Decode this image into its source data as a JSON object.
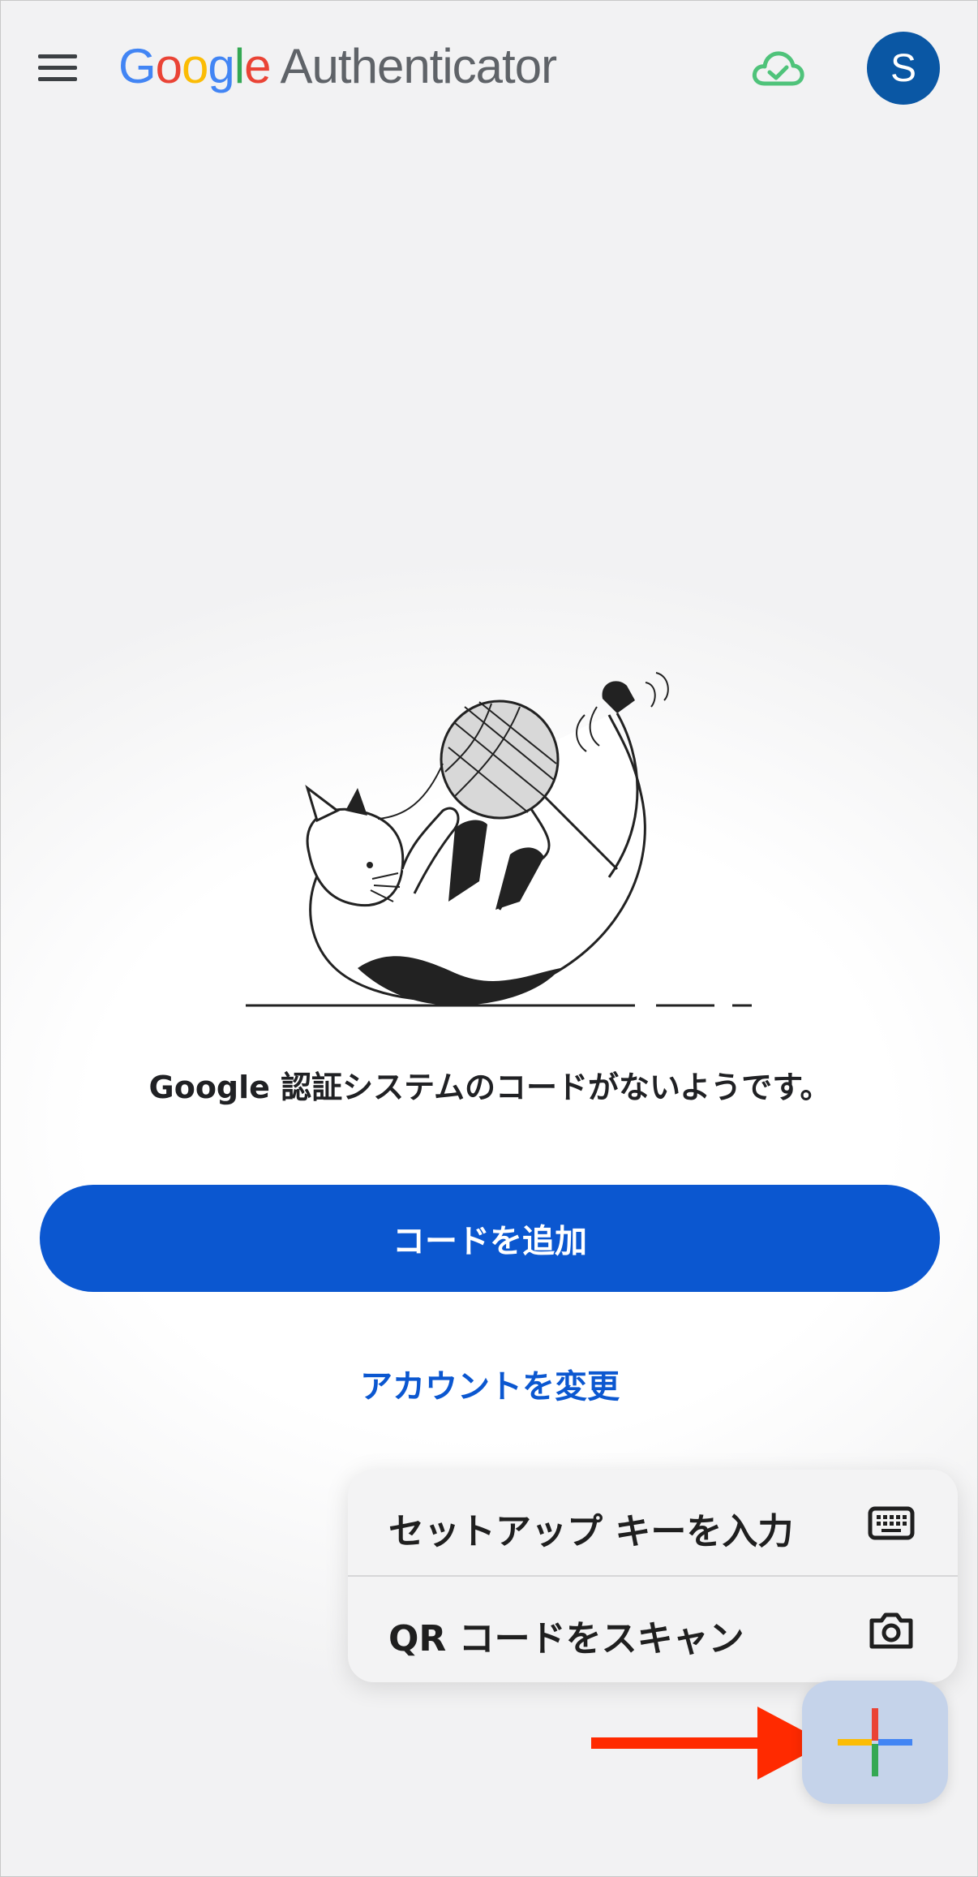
{
  "header": {
    "logo_google": [
      "G",
      "o",
      "o",
      "g",
      "l",
      "e"
    ],
    "app_name": "Authenticator",
    "avatar_initial": "S"
  },
  "main": {
    "empty_message": "Google 認証システムのコードがないようです。",
    "add_code_label": "コードを追加",
    "change_account_label": "アカウントを変更"
  },
  "popup_menu": {
    "items": [
      {
        "label": "セットアップ キーを入力",
        "icon": "keyboard-icon"
      },
      {
        "label": "QR コードをスキャン",
        "icon": "camera-icon"
      }
    ]
  },
  "fab": {
    "icon": "plus-icon"
  },
  "colors": {
    "primary": "#0b57d0",
    "avatar": "#0a57a4",
    "cloud_sync": "#4fc37a",
    "annotation_arrow": "#ff2a00",
    "fab_bg": "#c5d3ea"
  }
}
